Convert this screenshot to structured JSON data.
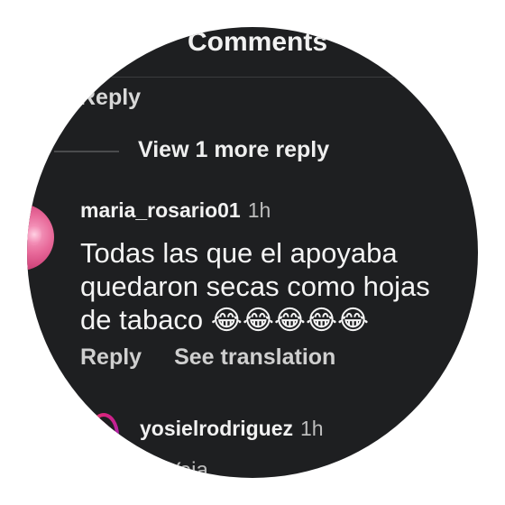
{
  "header": {
    "title": "Comments"
  },
  "thread_top": {
    "reply_label": "Reply"
  },
  "view_more": {
    "label": "View 1 more reply"
  },
  "comment1": {
    "username": "maria_rosario01",
    "time": "1h",
    "text": "Todas las que el apoyaba quedaron secas como hojas de tabaco",
    "emojis": "😂😂😂😂😂",
    "reply_label": "Reply",
    "translate_label": "See translation"
  },
  "comment2": {
    "username": "yosielrodriguez",
    "time": "1h",
    "partial_text": "Yeia"
  }
}
